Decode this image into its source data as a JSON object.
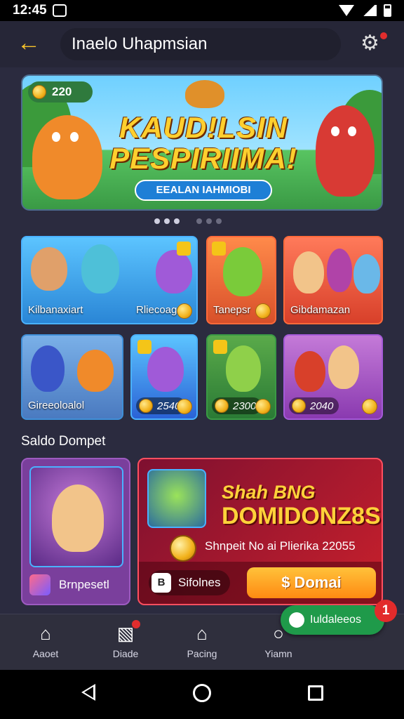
{
  "status_bar": {
    "time": "12:45"
  },
  "header": {
    "title": "Inaelo Uhapmsian",
    "back_icon": "arrow-left-icon",
    "settings_icon": "network-settings-icon"
  },
  "banner": {
    "coins": "220",
    "title_line1": "KAUD!LSIN",
    "title_line2": "PESPIRIIMA!",
    "cta": "EEALAN IAHMIOBI",
    "page_count": 7,
    "active_page": 0
  },
  "games_row1": [
    {
      "label": "Kilbanaxiart",
      "extra": "Rliecoagr",
      "bg": "#3aa6e8"
    },
    {
      "label": "Tanepsr",
      "bg": "#e8603a"
    },
    {
      "label": "Gibdamazan",
      "bg": "#e2572e"
    }
  ],
  "games_row2": [
    {
      "label": "Gireeoloalol",
      "bg": "#5f9ed8"
    },
    {
      "label": "2540",
      "bg": "#3f74d6"
    },
    {
      "label": "2300",
      "bg": "#3a9a45"
    },
    {
      "label": "2040",
      "bg": "#a45ad8"
    }
  ],
  "section": {
    "title": "Saldo Dompet"
  },
  "wallet_left": {
    "label": "Brnpesetl"
  },
  "wallet_right": {
    "headline1": "Shah BNG",
    "headline2": "DOMIDONZ8S!",
    "info": "Shnpeit No ai Plierika 22055",
    "method_icon_text": "B",
    "method_label": "Sifolnes",
    "pay_button": "$ Domai"
  },
  "bottom_nav": [
    {
      "label": "Aaoet",
      "icon": "home-icon"
    },
    {
      "label": "Diade",
      "icon": "cart-icon",
      "has_badge": true
    },
    {
      "label": "Pacing",
      "icon": "store-icon"
    },
    {
      "label": "Yiamn",
      "icon": "search-icon"
    }
  ],
  "fab": {
    "label": "Iuldaleeos",
    "count": "1",
    "icon": "chat-icon"
  },
  "colors": {
    "accent": "#f7c22a",
    "background": "#2b2b3f",
    "pay_button": "#ff9a1e",
    "fab": "#1f9a4a"
  }
}
